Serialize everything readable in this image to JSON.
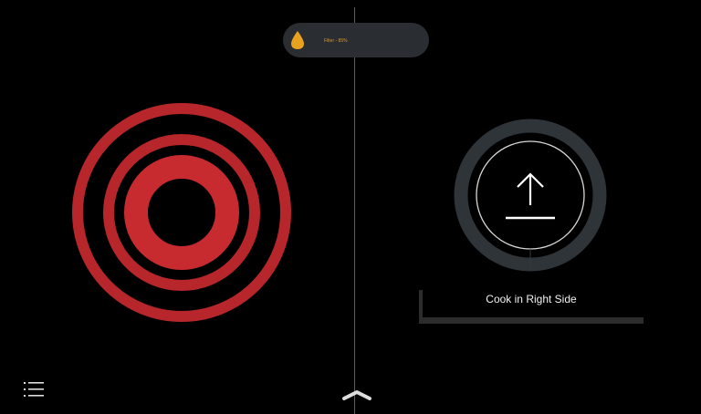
{
  "status_bar": {
    "filter_label": "Filter - 85%",
    "filter_icon": "water-drop-icon",
    "filter_icon_color": "#e8a21f"
  },
  "left_zone": {
    "state": "active-heating",
    "ring_color": "#b7262a"
  },
  "right_zone": {
    "icon": "upload-arrow-icon",
    "ring_color": "#2f3438",
    "label": "Cook in Right Side"
  },
  "bottom_nav": {
    "menu_icon": "menu-list-icon",
    "expand_icon": "chevron-up-icon"
  }
}
